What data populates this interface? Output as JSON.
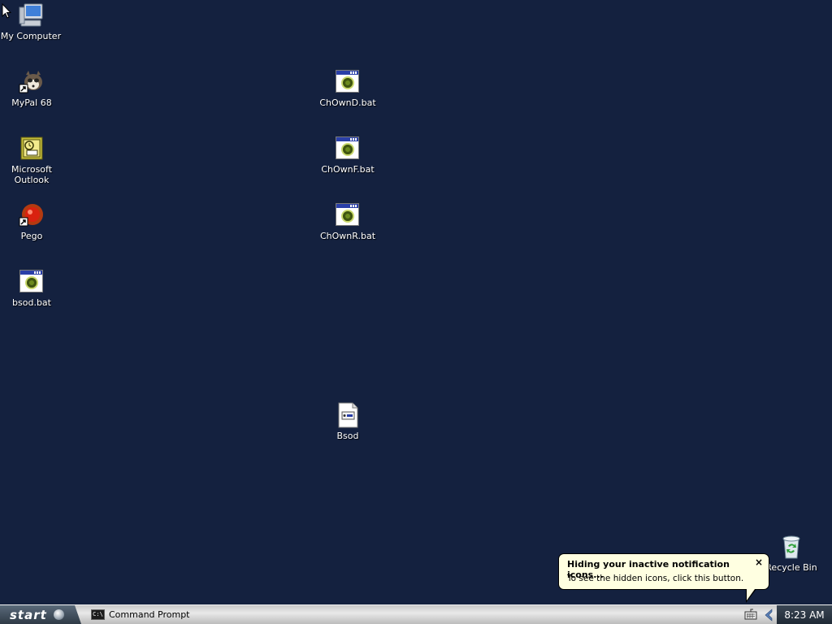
{
  "desktop": {
    "icons": {
      "my_computer": "My Computer",
      "mypal": "MyPal 68",
      "outlook": "Microsoft\nOutlook",
      "pego": "Pego",
      "bsod_bat": "bsod.bat",
      "chownd": "ChOwnD.bat",
      "chownf": "ChOwnF.bat",
      "chownr": "ChOwnR.bat",
      "bsod": "Bsod",
      "recycle_bin": "Recycle Bin"
    },
    "background_color": "#14213f"
  },
  "taskbar": {
    "start_label": "start",
    "tasks": [
      {
        "label": "Command Prompt",
        "icon": "command-prompt-icon",
        "icon_text": "C:\\"
      }
    ],
    "clock": "8:23 AM"
  },
  "balloon": {
    "title": "Hiding your inactive notification icons...",
    "body": "To see the hidden icons, click this button.",
    "close_glyph": "×"
  }
}
